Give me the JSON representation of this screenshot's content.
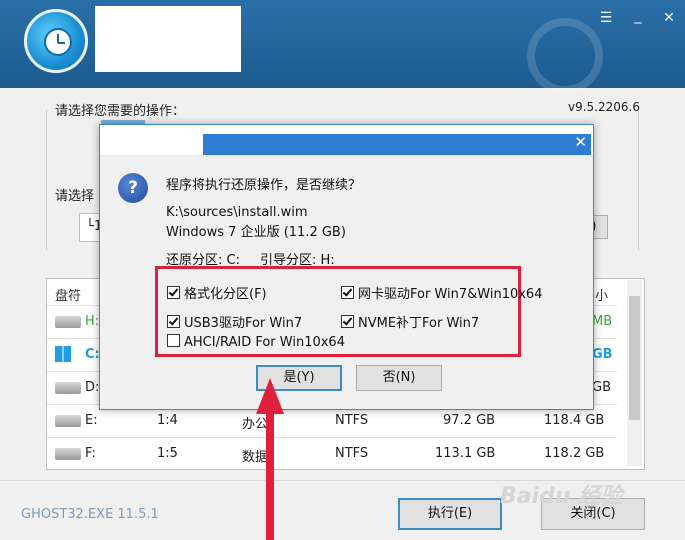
{
  "header": {
    "minimize": "☰",
    "min2": "_",
    "close": "✕"
  },
  "main": {
    "op_label": "请选择您需要的操作：",
    "version": "v9.5.2206.6",
    "select_label": "请选择",
    "partial_path": "└1",
    "partial_btn": ")"
  },
  "table": {
    "headers": [
      "盘符",
      "小"
    ],
    "rows": [
      {
        "drive": "H:",
        "num": "",
        "name": "",
        "fs": "",
        "free": "",
        "total": "MB"
      },
      {
        "drive": "C:",
        "num": "",
        "name": "",
        "fs": "",
        "free": "",
        "total": "GB"
      },
      {
        "drive": "D:",
        "num": "",
        "name": "",
        "fs": "",
        "free": "",
        "total": "GB"
      },
      {
        "drive": "E:",
        "num": "1:4",
        "name": "办公",
        "fs": "NTFS",
        "free": "97.2 GB",
        "total": "118.4 GB"
      },
      {
        "drive": "F:",
        "num": "1:5",
        "name": "数据",
        "fs": "NTFS",
        "free": "113.1 GB",
        "total": "118.2 GB"
      }
    ]
  },
  "footer": {
    "ghost": "GHOST32.EXE 11.5.1",
    "execute": "执行(E)",
    "close": "关闭(C)"
  },
  "dialog": {
    "close": "✕",
    "icon": "?",
    "question": "程序将执行还原操作，是否继续？",
    "path": "K:\\sources\\install.wim",
    "edition": "Windows 7 企业版 (11.2 GB)",
    "restore_part": "还原分区: C:",
    "boot_part": "引导分区: H:",
    "options": [
      {
        "label": "格式化分区(F)",
        "checked": true
      },
      {
        "label": "网卡驱动For Win7&Win10x64",
        "checked": true
      },
      {
        "label": "USB3驱动For Win7",
        "checked": true
      },
      {
        "label": "NVME补丁For Win7",
        "checked": true
      },
      {
        "label": "AHCI/RAID For Win10x64",
        "checked": false
      }
    ],
    "yes": "是(Y)",
    "no": "否(N)"
  },
  "watermark": "Baidu 经验",
  "colors": {
    "header": "#1d5b8f",
    "accent": "#2d7dd2",
    "highlight": "#e0203a"
  }
}
